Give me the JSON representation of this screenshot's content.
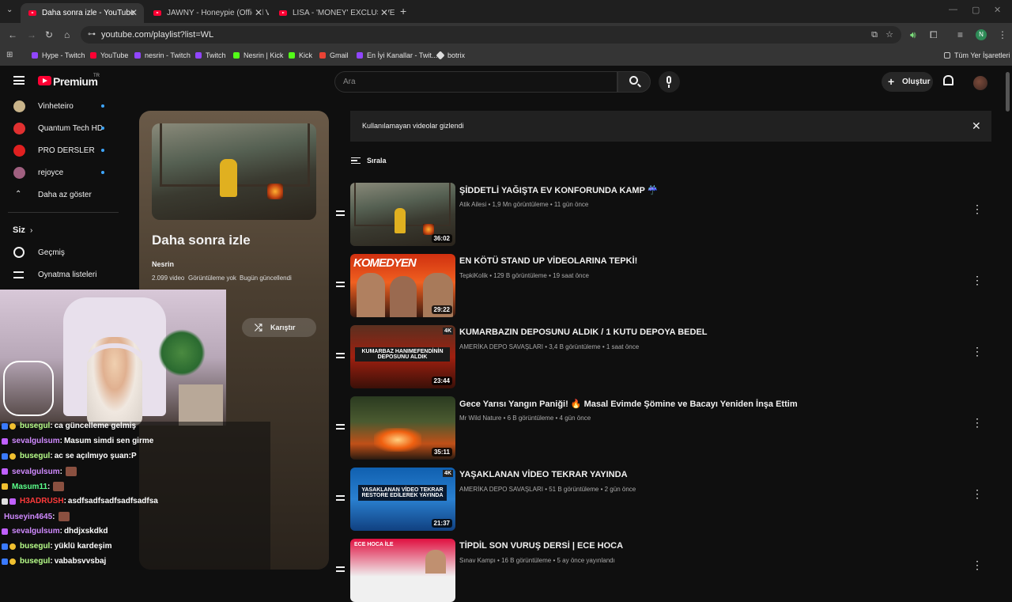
{
  "browser": {
    "tabs": [
      {
        "title": "Daha sonra izle - YouTube",
        "active": true
      },
      {
        "title": "JAWNY - Honeypie (Official Vid",
        "active": false
      },
      {
        "title": "LISA - 'MONEY' EXCLUSIVE PER",
        "active": false
      }
    ],
    "url": "youtube.com/playlist?list=WL",
    "profile_initial": "N",
    "bookmarks": [
      "Hype - Twitch",
      "YouTube",
      "nesrin - Twitch",
      "Twitch",
      "Nesrin | Kick",
      "Kick",
      "Gmail",
      "En İyi Kanallar - Twit...",
      "botrix"
    ],
    "all_bookmarks": "Tüm Yer İşaretleri"
  },
  "youtube": {
    "logo": "Premium",
    "logo_region": "TR",
    "search_placeholder": "Ara",
    "create_label": "Oluştur",
    "sidebar": {
      "subscriptions": [
        {
          "name": "Vinheteiro",
          "color": "#c9b48a"
        },
        {
          "name": "Quantum Tech HD",
          "color": "#e03030"
        },
        {
          "name": "PRO DERSLER",
          "color": "#e02020"
        },
        {
          "name": "rejoyce",
          "color": "#a06080"
        }
      ],
      "show_less": "Daha az göster",
      "you_label": "Siz",
      "history": "Geçmiş",
      "playlists": "Oynatma listeleri"
    },
    "playlist": {
      "title": "Daha sonra izle",
      "owner": "Nesrin",
      "video_count": "2.099 video",
      "views": "Görüntüleme yok",
      "updated": "Bugün güncellendi",
      "shuffle": "Karıştır"
    },
    "banner": "Kullanılamayan videolar gizlendi",
    "sort_label": "Sırala",
    "videos": [
      {
        "title": "ŞİDDETLİ YAĞIŞTA EV KONFORUNDA KAMP ☔",
        "channel": "Atik Ailesi",
        "views": "1,9 Mn görüntüleme",
        "age": "11 gün önce",
        "duration": "36:02"
      },
      {
        "title": "EN KÖTÜ STAND UP VİDEOLARINA TEPKİ!",
        "channel": "TepkiKolik",
        "views": "129 B görüntüleme",
        "age": "19 saat önce",
        "duration": "29:22",
        "thumb_text": "KOMEDYEN"
      },
      {
        "title": "KUMARBAZIN DEPOSUNU ALDIK / 1 KUTU DEPOYA BEDEL",
        "channel": "AMERİKA DEPO SAVAŞLARI",
        "views": "3,4 B görüntüleme",
        "age": "1 saat önce",
        "duration": "23:44",
        "thumb_text": "KUMARBAZ HANIMEFENDİNİN DEPOSUNU ALDIK"
      },
      {
        "title": "Gece Yarısı Yangın Paniği! 🔥 Masal Evimde Şömine ve Bacayı Yeniden İnşa Ettim",
        "channel": "Mr Wild Nature",
        "views": "6 B görüntüleme",
        "age": "4 gün önce",
        "duration": "35:11"
      },
      {
        "title": "YAŞAKLANAN VİDEO TEKRAR YAYINDA",
        "channel": "AMERİKA DEPO SAVAŞLARI",
        "views": "51 B görüntüleme",
        "age": "2 gün önce",
        "duration": "21:37",
        "thumb_text": "YASAKLANAN VİDEO TEKRAR RESTORE EDİLEREK YAYINDA"
      },
      {
        "title": "TİPDİL SON VURUŞ DERSİ | ECE HOCA",
        "channel": "Sınav Kampı",
        "views": "16 B görüntüleme",
        "age": "5 ay önce yayınlandı",
        "duration": "",
        "thumb_text": "ECE HOCA İLE"
      }
    ]
  },
  "chat": [
    {
      "user": "busegul",
      "msg": "ca güncelleme gelmiş",
      "color": "#b8ff8a"
    },
    {
      "user": "sevalgulsum",
      "msg": "Masum simdi sen girme",
      "color": "#d08aff"
    },
    {
      "user": "busegul",
      "msg": "ac se açılmıyo şuan:P",
      "color": "#b8ff8a"
    },
    {
      "user": "sevalgulsum",
      "msg": "",
      "color": "#d08aff",
      "emote": true
    },
    {
      "user": "Masum11",
      "msg": "",
      "color": "#5aff8a",
      "emote": true
    },
    {
      "user": "H3ADRUSH",
      "msg": "asdfsadfsadfsadfsadfsa",
      "color": "#ff3a3a"
    },
    {
      "user": "Huseyin4645",
      "msg": "",
      "color": "#d08aff",
      "emote": true
    },
    {
      "user": "sevalgulsum",
      "msg": "dhdjxskdkd",
      "color": "#d08aff"
    },
    {
      "user": "busegul",
      "msg": "yüklü kardeşim",
      "color": "#b8ff8a"
    },
    {
      "user": "busegul",
      "msg": "vababsvvsbaj",
      "color": "#b8ff8a"
    }
  ]
}
